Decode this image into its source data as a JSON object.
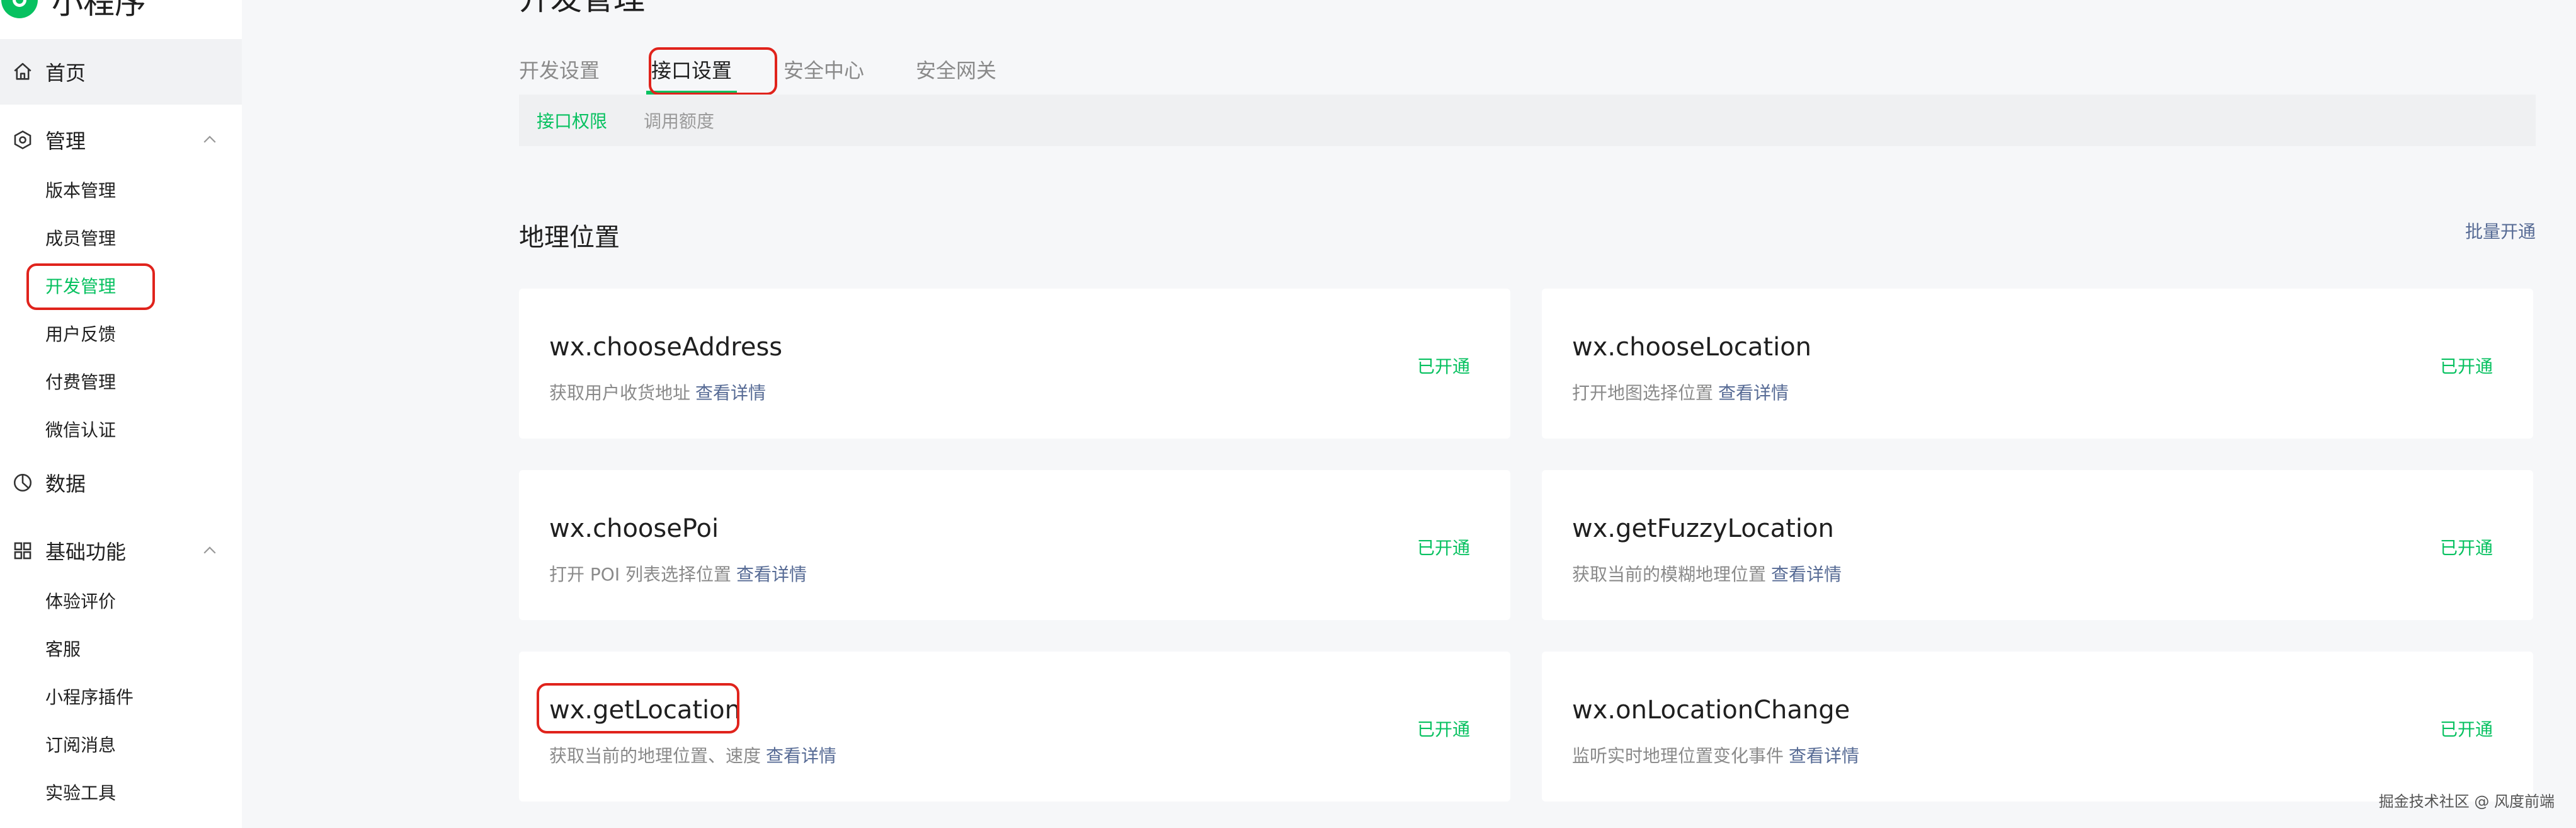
{
  "brand": {
    "name": "小程序"
  },
  "sidebar": {
    "home": {
      "label": "首页",
      "icon": "home-icon"
    },
    "manage": {
      "label": "管理",
      "icon": "gear-icon",
      "items": [
        "版本管理",
        "成员管理",
        "开发管理",
        "用户反馈",
        "付费管理",
        "微信认证"
      ],
      "active_item": "开发管理"
    },
    "data": {
      "label": "数据",
      "icon": "pie-chart-icon"
    },
    "basic": {
      "label": "基础功能",
      "icon": "grid-icon",
      "items": [
        "体验评价",
        "客服",
        "小程序插件",
        "订阅消息",
        "实验工具"
      ]
    }
  },
  "main": {
    "title": "开发管理",
    "tabs": [
      "开发设置",
      "接口设置",
      "安全中心",
      "安全网关"
    ],
    "active_tab": "接口设置",
    "subtabs": [
      "接口权限",
      "调用额度"
    ],
    "active_subtab": "接口权限",
    "section_title": "地理位置",
    "batch_action": "批量开通",
    "apis": [
      {
        "name": "wx.chooseAddress",
        "desc": "获取用户收货地址",
        "link": "查看详情",
        "status": "已开通"
      },
      {
        "name": "wx.chooseLocation",
        "desc": "打开地图选择位置",
        "link": "查看详情",
        "status": "已开通"
      },
      {
        "name": "wx.choosePoi",
        "desc": "打开 POI 列表选择位置",
        "link": "查看详情",
        "status": "已开通"
      },
      {
        "name": "wx.getFuzzyLocation",
        "desc": "获取当前的模糊地理位置",
        "link": "查看详情",
        "status": "已开通"
      },
      {
        "name": "wx.getLocation",
        "desc": "获取当前的地理位置、速度",
        "link": "查看详情",
        "status": "已开通"
      },
      {
        "name": "wx.onLocationChange",
        "desc": "监听实时地理位置变化事件",
        "link": "查看详情",
        "status": "已开通"
      }
    ]
  },
  "watermark": "掘金技术社区 @ 风度前端",
  "colors": {
    "accent": "#07c160",
    "link": "#576b95",
    "highlight": "#e0231c"
  }
}
